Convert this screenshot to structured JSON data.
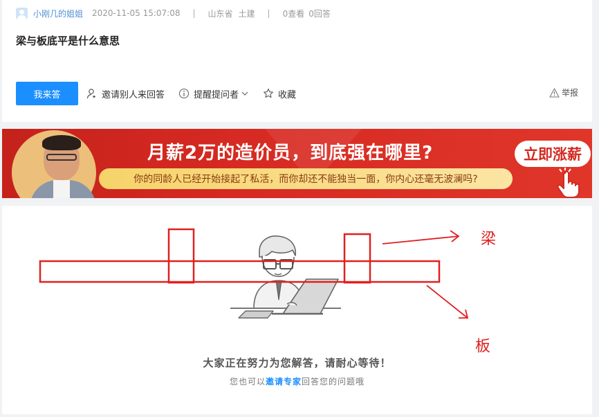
{
  "question": {
    "user": "小刚几的姐姐",
    "timestamp": "2020-11-05 15:07:08",
    "location": "山东省",
    "category": "土建",
    "views": "0查看",
    "answers": "0回答",
    "title": "梁与板底平是什么意思"
  },
  "actions": {
    "answer_button": "我来答",
    "invite": "邀请别人来回答",
    "remind": "提醒提问者",
    "collect": "收藏",
    "report": "举报"
  },
  "banner": {
    "headline": "月薪2万的造价员，到底强在哪里?",
    "subline": "你的同龄人已经开始接起了私活，而你却还不能独当一面，你内心还毫无波澜吗?",
    "cta": "立即涨薪"
  },
  "answer_area": {
    "waiting_text": "大家正在努力为您解答，请耐心等待！",
    "hint_prefix": "您也可以",
    "hint_link": "邀请专家",
    "hint_suffix": "回答您的问题哦"
  },
  "annotations": {
    "beam_label": "梁",
    "slab_label": "板",
    "color": "#e02020"
  },
  "colors": {
    "primary": "#1b8fff",
    "banner_red": "#d62a22",
    "banner_pill": "#f6d36a"
  }
}
